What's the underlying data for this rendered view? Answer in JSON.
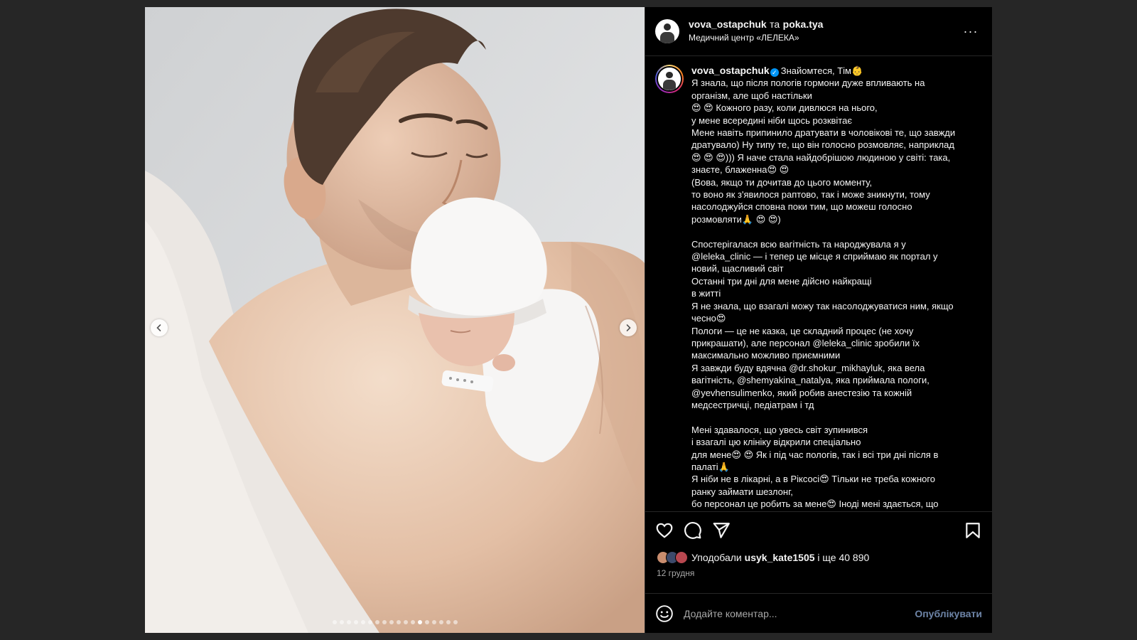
{
  "post": {
    "author": "vova_ostapchuk",
    "conj": "та",
    "collaborator": "poka.tya",
    "location": "Медичний центр «ЛЕЛЕКА»",
    "more_label": "···"
  },
  "media": {
    "dot_count": 18,
    "active_dot": 12,
    "prev_label": "‹",
    "next_label": "›"
  },
  "caption": {
    "username": "vova_ostapchuk",
    "lines": [
      "Знайомтеся, Тім👶",
      "Я знала, що після пологів гормони дуже впливають на",
      "організм, але щоб настільки",
      "😍 😍  Кожного разу, коли дивлюся на нього,",
      "у мене всередині ніби щось розквітає",
      "Мене навіть припинило дратувати в чоловікові те, що завжди",
      "дратувало) Ну типу те, що він голосно розмовляє, наприклад",
      "😍 😍 😍))) Я наче стала найдобрішою людиною у світі: така,",
      "знаєте, блаженна😍 😍",
      "(Вова, якщо ти дочитав до цього моменту,",
      "то воно як з'явилося раптово, так і може зникнути, тому",
      "насолоджуйся сповна поки тим, що можеш голосно",
      "розмовляти🙏 😍 😍)",
      "",
      "Спостерігалася всю вагітність та народжувала я у",
      "@leleka_clinic — і тепер це місце я сприймаю як портал у",
      "новий, щасливий світ",
      "Останні три дні для мене дійсно найкращі",
      "в житті",
      "Я не знала, що взагалі можу так насолоджуватися ним, якщо",
      "чесно😍",
      "Пологи — це не казка, це складний процес (не хочу",
      "прикрашати), але персонал @leleka_clinic зробили їх",
      "максимально можливо приємними",
      "Я завжди буду вдячна @dr.shokur_mikhayluk, яка вела",
      "вагітність, @shemyakina_natalya, яка приймала пологи,",
      "@yevhensulimenko, який робив анестезію та кожній",
      "медсестричці, педіатрам і тд",
      "",
      "Мені здавалося, що увесь світ зупинився",
      "і взагалі цю клініку відкрили спеціально",
      "для мене😍 😍  Як і під час пологів, так і всі три дні після в",
      "палаті🙏",
      "Я ніби не в лікарні, а в Ріксосі😍  Тільки не треба кожного",
      "ранку займати шезлонг,",
      "бо персонал це робить за мене😍  Іноді мені здається, що"
    ]
  },
  "likes": {
    "prefix": "Уподобали",
    "user": "usyk_kate1505",
    "suffix": "і ще 40 890"
  },
  "date": "12 грудня",
  "comment": {
    "placeholder": "Додайте коментар...",
    "publish": "Опублікувати"
  }
}
